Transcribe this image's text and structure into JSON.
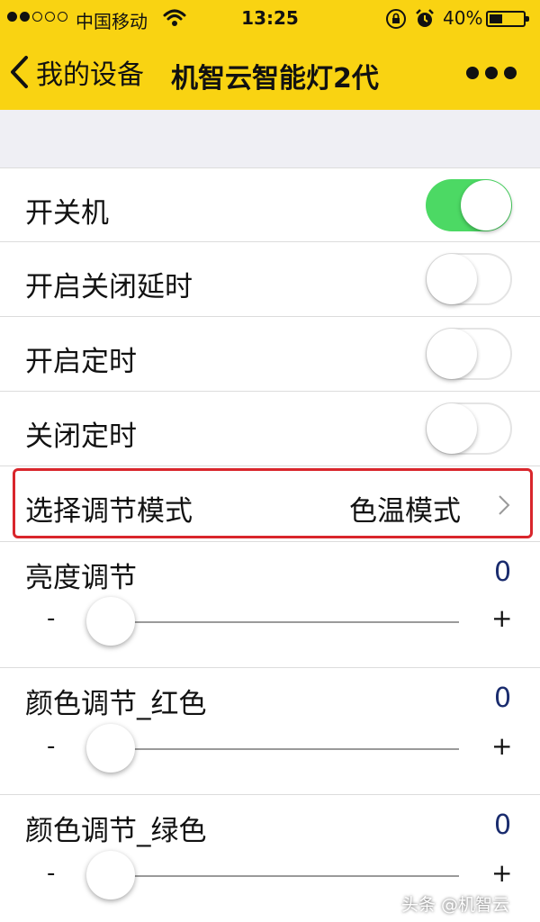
{
  "status_bar": {
    "signal_dots_filled": 2,
    "signal_dots_total": 5,
    "carrier": "中国移动",
    "time": "13:25",
    "battery": "40%",
    "battery_level": 0.4,
    "icons": [
      "wifi-icon",
      "orientation-lock-icon",
      "alarm-icon",
      "battery-icon"
    ]
  },
  "navbar": {
    "back_label": "我的设备",
    "title": "机智云智能灯2代",
    "background_color": "#f9d312",
    "more_icon": "more-dots-icon"
  },
  "toggles": [
    {
      "label": "开关机",
      "on": true
    },
    {
      "label": "开启关闭延时",
      "on": false
    },
    {
      "label": "开启定时",
      "on": false
    },
    {
      "label": "关闭定时",
      "on": false
    }
  ],
  "mode_row": {
    "label": "选择调节模式",
    "value": "色温模式",
    "highlight_color": "#d9262c"
  },
  "sliders": [
    {
      "label": "亮度调节",
      "value": "0",
      "minus": "-",
      "plus": "+"
    },
    {
      "label": "颜色调节_红色",
      "value": "0",
      "minus": "-",
      "plus": "+"
    },
    {
      "label": "颜色调节_绿色",
      "value": "0",
      "minus": "-",
      "plus": "+"
    }
  ],
  "colors": {
    "switch_on": "#4cd964",
    "slider_value": "#1a2c6e"
  },
  "watermark": "头条 @机智云"
}
